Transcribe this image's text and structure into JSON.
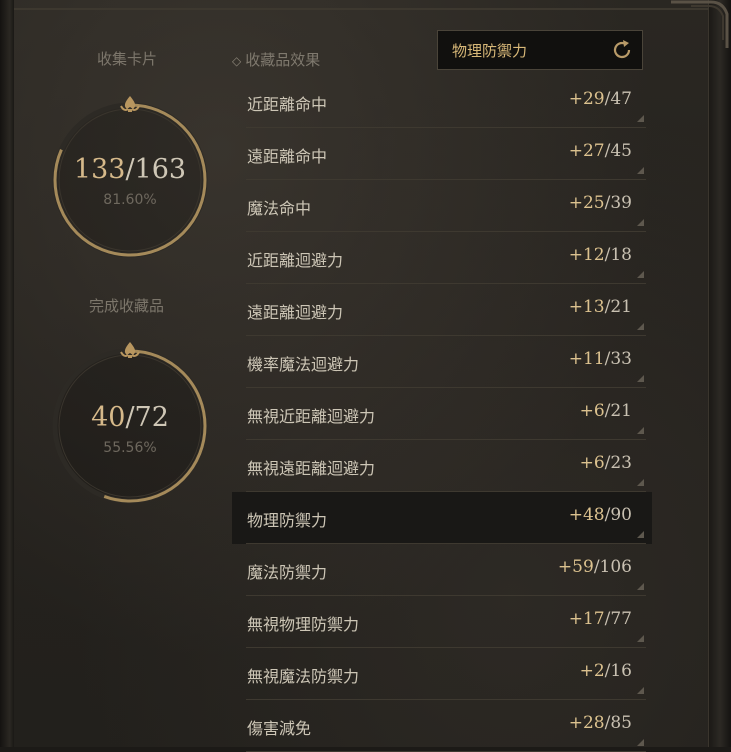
{
  "collection_cards": {
    "title": "收集卡片",
    "collected": "133",
    "total": "/163",
    "percent_text": "81.60%",
    "fraction": 0.816
  },
  "completed_collections": {
    "title": "完成收藏品",
    "collected": "40",
    "total": "/72",
    "percent_text": "55.56%",
    "fraction": 0.5556
  },
  "effects": {
    "header": "收藏品效果",
    "filter_label": "物理防禦力",
    "rows": [
      {
        "name": "近距離命中",
        "gain": "+29",
        "max": "/47"
      },
      {
        "name": "遠距離命中",
        "gain": "+27",
        "max": "/45"
      },
      {
        "name": "魔法命中",
        "gain": "+25",
        "max": "/39"
      },
      {
        "name": "近距離迴避力",
        "gain": "+12",
        "max": "/18"
      },
      {
        "name": "遠距離迴避力",
        "gain": "+13",
        "max": "/21"
      },
      {
        "name": "機率魔法迴避力",
        "gain": "+11",
        "max": "/33"
      },
      {
        "name": "無視近距離迴避力",
        "gain": "+6",
        "max": "/21"
      },
      {
        "name": "無視遠距離迴避力",
        "gain": "+6",
        "max": "/23"
      },
      {
        "name": "物理防禦力",
        "gain": "+48",
        "max": "/90"
      },
      {
        "name": "魔法防禦力",
        "gain": "+59",
        "max": "/106"
      },
      {
        "name": "無視物理防禦力",
        "gain": "+17",
        "max": "/77"
      },
      {
        "name": "無視魔法防禦力",
        "gain": "+2",
        "max": "/16"
      },
      {
        "name": "傷害減免",
        "gain": "+28",
        "max": "/85"
      }
    ],
    "selected_index": 8
  },
  "colors": {
    "gold": "#d6b98a",
    "ring_gold": "#a58a5a",
    "text": "#cdc6b6"
  },
  "icons": [
    "refresh-icon",
    "fleur-ornament-icon",
    "diamond-bullet-icon",
    "corner-triangle-icon"
  ]
}
